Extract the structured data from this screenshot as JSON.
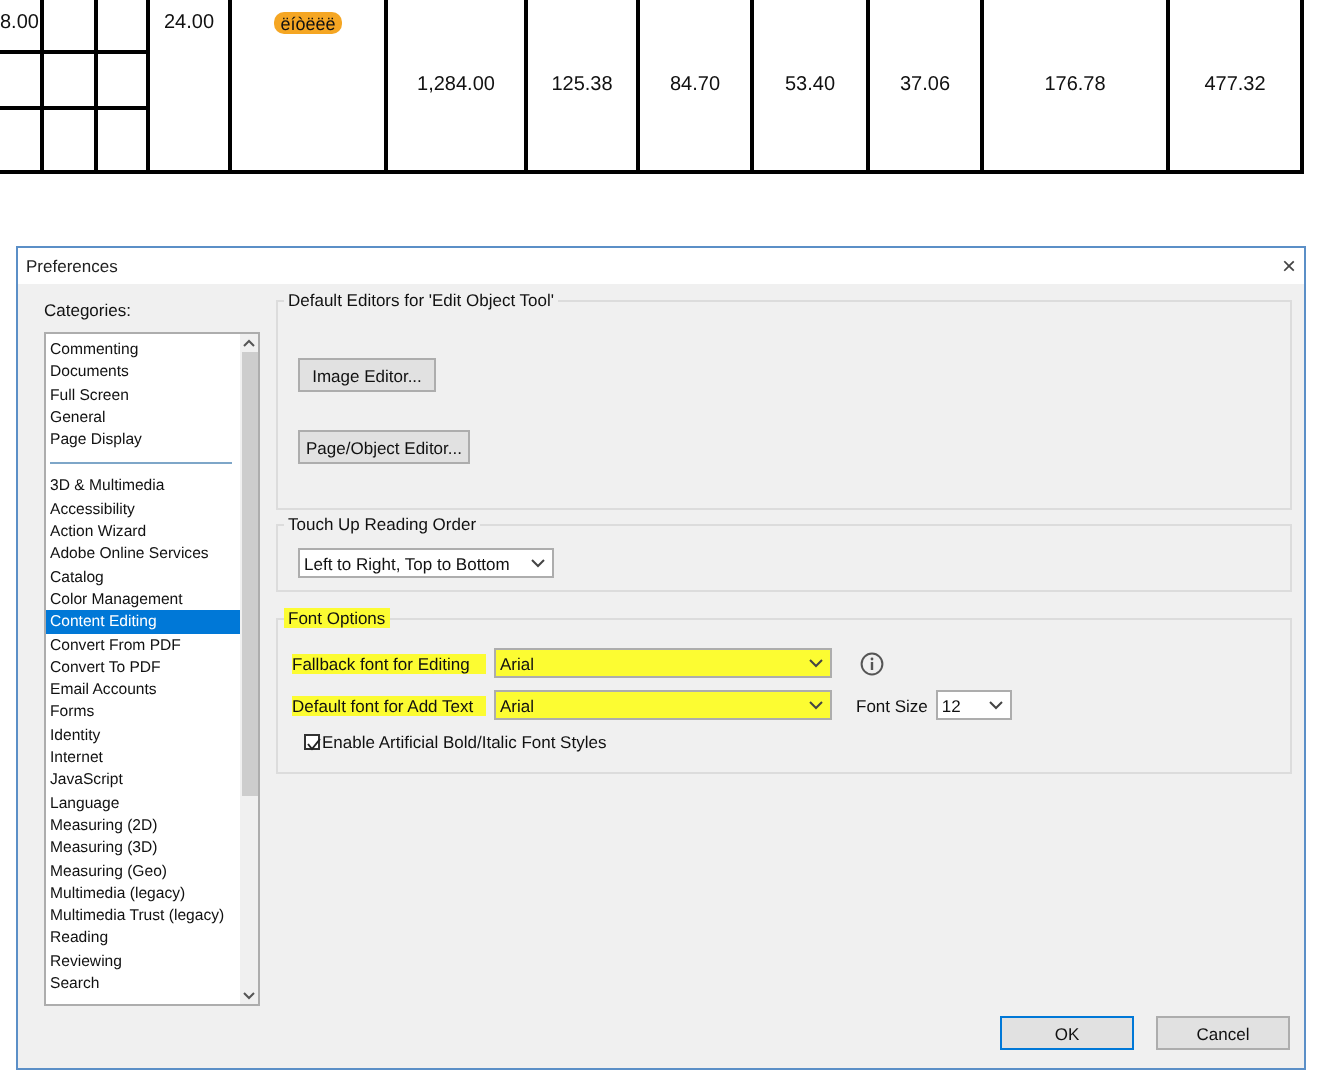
{
  "table": {
    "columns": [
      {
        "kind": "split",
        "text": "8.00"
      },
      {
        "kind": "split"
      },
      {
        "kind": "split"
      },
      {
        "kind": "top",
        "text": "24.00"
      },
      {
        "kind": "badge",
        "text": "ëíòëëë"
      },
      {
        "kind": "middle",
        "text": "1,284.00"
      },
      {
        "kind": "middle",
        "text": "125.38"
      },
      {
        "kind": "middle",
        "text": "84.70"
      },
      {
        "kind": "middle",
        "text": "53.40"
      },
      {
        "kind": "middle",
        "text": "37.06"
      },
      {
        "kind": "middle",
        "text": "176.78"
      },
      {
        "kind": "middle",
        "text": "477.32"
      }
    ]
  },
  "window": {
    "title": "Preferences",
    "close": "×"
  },
  "sidebar": {
    "label": "Categories:",
    "items": [
      {
        "kind": "item",
        "label": "Commenting",
        "selected": false
      },
      {
        "kind": "item",
        "label": "Documents",
        "selected": false
      },
      {
        "kind": "item",
        "label": "Full Screen",
        "selected": false
      },
      {
        "kind": "item",
        "label": "General",
        "selected": false
      },
      {
        "kind": "item",
        "label": "Page Display",
        "selected": false
      },
      {
        "kind": "separator"
      },
      {
        "kind": "item",
        "label": "3D & Multimedia",
        "selected": false
      },
      {
        "kind": "item",
        "label": "Accessibility",
        "selected": false
      },
      {
        "kind": "item",
        "label": "Action Wizard",
        "selected": false
      },
      {
        "kind": "item",
        "label": "Adobe Online Services",
        "selected": false
      },
      {
        "kind": "item",
        "label": "Catalog",
        "selected": false
      },
      {
        "kind": "item",
        "label": "Color Management",
        "selected": false
      },
      {
        "kind": "item",
        "label": "Content Editing",
        "selected": true
      },
      {
        "kind": "item",
        "label": "Convert From PDF",
        "selected": false
      },
      {
        "kind": "item",
        "label": "Convert To PDF",
        "selected": false
      },
      {
        "kind": "item",
        "label": "Email Accounts",
        "selected": false
      },
      {
        "kind": "item",
        "label": "Forms",
        "selected": false
      },
      {
        "kind": "item",
        "label": "Identity",
        "selected": false
      },
      {
        "kind": "item",
        "label": "Internet",
        "selected": false
      },
      {
        "kind": "item",
        "label": "JavaScript",
        "selected": false
      },
      {
        "kind": "item",
        "label": "Language",
        "selected": false
      },
      {
        "kind": "item",
        "label": "Measuring (2D)",
        "selected": false
      },
      {
        "kind": "item",
        "label": "Measuring (3D)",
        "selected": false
      },
      {
        "kind": "item",
        "label": "Measuring (Geo)",
        "selected": false
      },
      {
        "kind": "item",
        "label": "Multimedia (legacy)",
        "selected": false
      },
      {
        "kind": "item",
        "label": "Multimedia Trust (legacy)",
        "selected": false
      },
      {
        "kind": "item",
        "label": "Reading",
        "selected": false
      },
      {
        "kind": "item",
        "label": "Reviewing",
        "selected": false
      },
      {
        "kind": "item",
        "label": "Search",
        "selected": false
      }
    ]
  },
  "editors": {
    "title": "Default Editors for 'Edit Object Tool'",
    "buttons": [
      "Image Editor...",
      "Page/Object Editor..."
    ]
  },
  "reading_order": {
    "title": "Touch Up Reading Order",
    "value": "Left to Right, Top to Bottom"
  },
  "font_options": {
    "title": "Font Options",
    "highlighted": true,
    "fallback": {
      "label": "Fallback font for Editing",
      "value": "Arial",
      "highlighted": true
    },
    "default": {
      "label": "Default font for Add Text",
      "value": "Arial",
      "highlighted": true
    },
    "size": {
      "label": "Font Size",
      "value": "12"
    },
    "artificial": {
      "label": "Enable Artificial Bold/Italic Font Styles",
      "checked": true
    }
  },
  "buttons": [
    {
      "label": "OK",
      "focused": true
    },
    {
      "label": "Cancel",
      "focused": false
    }
  ]
}
